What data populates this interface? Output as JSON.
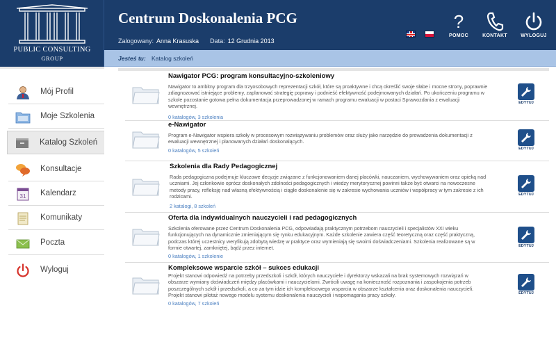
{
  "header": {
    "app_title": "Centrum Doskonalenia PCG",
    "logged_label": "Zalogowany:",
    "user_name": "Anna Krasuska",
    "date_label": "Data:",
    "date_value": "12 Grudnia 2013",
    "logo_line1": "PUBLIC CONSULTING",
    "logo_line2": "GROUP",
    "buttons": {
      "help": "POMOC",
      "contact": "KONTAKT",
      "logout": "WYLOGUJ"
    },
    "colors": {
      "header_bg": "#1b3d6b",
      "breadcrumb_bg": "#a9c4e6"
    }
  },
  "breadcrumb": {
    "label": "Jesteś tu:",
    "current": "Katalog szkoleń"
  },
  "sidebar": {
    "items": [
      {
        "label": "Mój Profil",
        "icon": "user-icon"
      },
      {
        "label": "Moje Szkolenia",
        "icon": "folder-icon"
      },
      {
        "label": "Katalog Szkoleń",
        "icon": "catalog-icon",
        "active": true
      },
      {
        "label": "Konsultacje",
        "icon": "chat-bubbles-icon"
      },
      {
        "label": "Kalendarz",
        "icon": "calendar-icon"
      },
      {
        "label": "Komunikaty",
        "icon": "notes-icon"
      },
      {
        "label": "Poczta",
        "icon": "mail-icon"
      },
      {
        "label": "Wyloguj",
        "icon": "power-icon"
      }
    ]
  },
  "catalogs": [
    {
      "title": "Nawigator PCG: program konsultacyjno-szkoleniowy",
      "description": "Nawigator to ambitny program dla trzyosobowych reprezentacji szkół, które są proaktywne i chcą określić swoje słabe i mocne strony, poprawnie zdiagnozować istniejące problemy, zaplanować strategię poprawy i podnieść efektywność podejmowanych działań. Po ukończeniu programu w szkole pozostanie gotowa pełna dokumentacja przeprowadzonej w ramach programu ewaluacji w postaci Sprawozdania z ewaluacji wewnętrznej.",
      "meta": "0 katalogów, 3 szkolenia",
      "edit_label": "EDYTUJ"
    },
    {
      "title": "e-Nawigator",
      "description": "Program e-Nawigator wspiera szkoły w procesowym rozwiązywaniu problemów oraz służy jako narzędzie do prowadzenia dokumentacji z ewaluacji wewnętrznej i planowanych działań doskonalących.",
      "meta": "0 katalogów, 5 szkoleń",
      "edit_label": "EDYTUJ"
    },
    {
      "title": "Szkolenia dla Rady Pedagogicznej",
      "description": "Rada pedagogiczna podejmuje kluczowe decyzje związane z funkcjonowaniem danej placówki, nauczaniem, wychowywaniem oraz opieką nad uczniami. Jej członkowie oprócz doskonałych zdolności pedagogicznych i wiedzy merytorycznej powinni także być otwarci na nowoczesne metody pracy, refleksję nad własną efektywnością i ciągłe doskonalenie się w zakresie wychowania uczniów i współpracy w tym zakresie z ich rodzicami.",
      "meta": "2 katalogi, 8 szkoleń",
      "edit_label": "EDYTUJ"
    },
    {
      "title": "Oferta dla indywidualnych nauczycieli i rad pedagogicznych",
      "description": "Szkolenia oferowane przez Centrum Doskonalenia PCG, odpowiadają praktycznym potrzebom nauczycieli i specjalistów XXI wieku funkcjonujących na dynamicznie zmieniającym się rynku edukacyjnym. Każde szkolenie zawiera część teoretyczną oraz część praktyczną, podczas której uczestnicy weryfikują zdobytą wiedzę w praktyce oraz wymieniają się swoimi doświadczeniami. Szkolenia realizowane są w formie otwartej, zamkniętej, bądź przez internet.",
      "meta": "0 katalogów, 1 szkolenie",
      "edit_label": "EDYTUJ"
    },
    {
      "title": "Kompleksowe wsparcie szkół – sukces edukacji",
      "description": "Projekt stanowi odpowiedź na potrzeby przedszkoli i szkół, których nauczyciele i dyrektorzy wskazali na brak systemowych rozwiązań w obszarze wymiany doświadczeń między placówkami i nauczycielami. Zwrócili uwagę na konieczność rozpoznania i zaspokojenia potrzeb poszczególnych szkół i przedszkoli, a co za tym idzie ich kompleksowego wsparcia w obszarze kształcenia oraz doskonalenia nauczycieli. Projekt stanowi pilotaż nowego modelu systemu doskonalenia nauczycieli i wspomagania pracy szkoły.",
      "meta": "0 katalogów, 7 szkoleń",
      "edit_label": "EDYTUJ"
    }
  ]
}
